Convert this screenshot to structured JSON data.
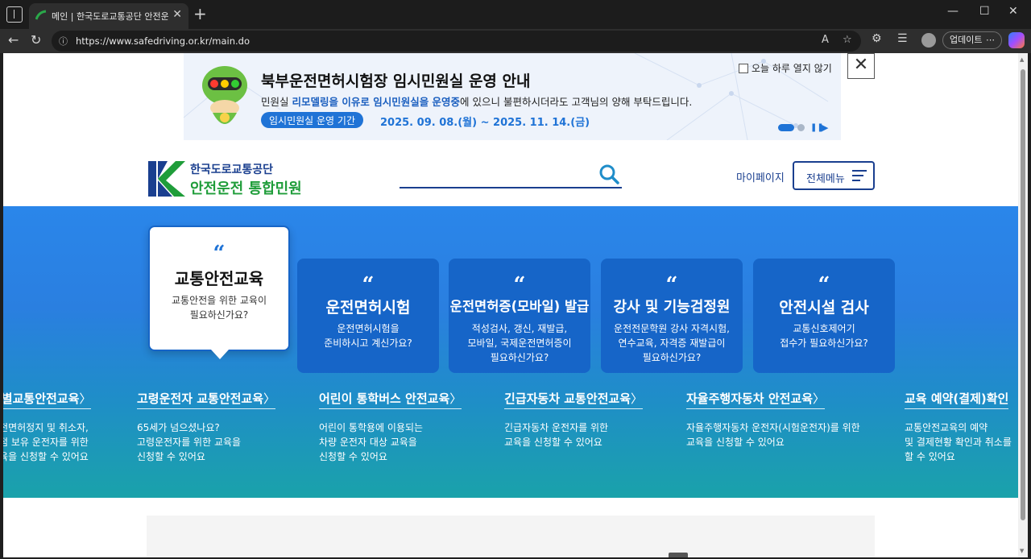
{
  "browser": {
    "tab_title": "메인 | 한국도로교통공단 안전운전",
    "url": "https://www.safedriving.or.kr/main.do",
    "update_label": "업데이트",
    "reader_label": "A",
    "new_tab_symbol": "+",
    "close_symbol": "✕",
    "minimize_symbol": "—",
    "maximize_symbol": "☐"
  },
  "notice": {
    "title": "북부운전면허시험장 임시민원실 운영 안내",
    "body_prefix": "민원실 ",
    "body_highlight1": "리모델링을 이유로 임시민원실을 운영중",
    "body_suffix": "에 있으니 불편하시더라도 고객님의 양해 부탁드립니다.",
    "period_label": "임시민원실 운영 기간",
    "period_dates": "2025. 09. 08.(월) ~ 2025. 11. 14.(금)",
    "dont_show_today": "오늘 하루 열지 않기",
    "close_symbol": "✕"
  },
  "header": {
    "logo_top": "한국도로교통공단",
    "logo_bottom": "안전운전 통합민원",
    "mypage": "마이페이지",
    "all_menu": "전체메뉴"
  },
  "hero_cards": [
    {
      "title": "교통안전교육",
      "desc": "교통안전을 위한 교육이\n필요하신가요?",
      "active": true
    },
    {
      "title": "운전면허시험",
      "desc": "운전면허시험을\n준비하시고 계신가요?"
    },
    {
      "title": "운전면허증(모바일) 발급",
      "desc": "적성검사, 갱신, 재발급,\n모바일, 국제운전면허증이\n필요하신가요?"
    },
    {
      "title": "강사 및 기능검정원",
      "desc": "운전전문학원 강사 자격시험,\n연수교육, 자격증 재발급이\n필요하신가요?"
    },
    {
      "title": "안전시설 검사",
      "desc": "교통신호제어기\n접수가 필요하신가요?"
    }
  ],
  "quote_mark": "“",
  "edu_items": [
    {
      "title": "특별교통안전교육",
      "desc": "운전면허정지 및 취소자,\n벌점 보유 운전자를 위한\n교육을 신청할 수 있어요"
    },
    {
      "title": "고령운전자 교통안전교육",
      "desc": "65세가 넘으셨나요?\n고령운전자를 위한 교육을\n신청할 수 있어요"
    },
    {
      "title": "어린이 통학버스 안전교육",
      "desc": "어린이 통학용에 이용되는\n차량 운전자 대상 교육을\n신청할 수 있어요"
    },
    {
      "title": "긴급자동차 교통안전교육",
      "desc": "긴급자동차 운전자를 위한\n교육을 신청할 수 있어요"
    },
    {
      "title": "자율주행자동차 안전교육",
      "desc": "자율주행자동차 운전자(시험운전자)를 위한\n교육을 신청할 수 있어요"
    },
    {
      "title": "교육 예약(결제)확인",
      "desc": "교통안전교육의 예약\n및 결제현황 확인과 취소를\n할 수 있어요"
    }
  ],
  "edu_arrow": "〉",
  "colors": {
    "primary": "#1665c8",
    "brand_green": "#1f9d3a",
    "brand_navy": "#1a3f8f"
  }
}
